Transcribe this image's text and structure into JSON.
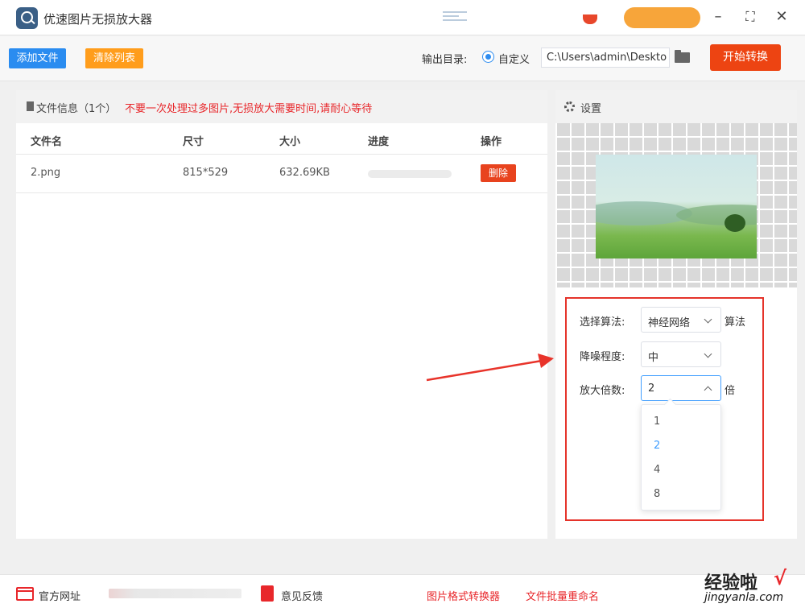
{
  "app": {
    "title": "优速图片无损放大器"
  },
  "toolbar": {
    "add_file": "添加文件",
    "clear_list": "清除列表",
    "output_dir_label": "输出目录:",
    "output_option": "自定义",
    "output_path": "C:\\Users\\admin\\Deskto",
    "start": "开始转换"
  },
  "file_panel": {
    "title": "文件信息（1个）",
    "warning": "不要一次处理过多图片,无损放大需要时间,请耐心等待",
    "columns": [
      "文件名",
      "尺寸",
      "大小",
      "进度",
      "操作"
    ],
    "rows": [
      {
        "name": "2.png",
        "size": "815*529",
        "filesize": "632.69KB",
        "progress": 0,
        "action": "删除"
      }
    ]
  },
  "settings": {
    "title": "设置",
    "algorithm_label": "选择算法:",
    "algorithm_value": "神经网络",
    "algorithm_suffix": "算法",
    "noise_label": "降噪程度:",
    "noise_value": "中",
    "scale_label": "放大倍数:",
    "scale_value": "2",
    "scale_suffix": "倍",
    "scale_options": [
      "1",
      "2",
      "4",
      "8"
    ],
    "scale_selected": "2"
  },
  "footer": {
    "website": "官方网址",
    "feedback": "意见反馈",
    "format_converter": "图片格式转换器",
    "batch_rename": "文件批量重命名"
  },
  "watermark": {
    "text": "经验啦",
    "check": "√",
    "url": "jingyanla.com"
  },
  "colors": {
    "primary": "#2a8cf0",
    "orange": "#ff9d1c",
    "start": "#ed4412",
    "danger": "#e8272b",
    "select_blue": "#409eff"
  }
}
